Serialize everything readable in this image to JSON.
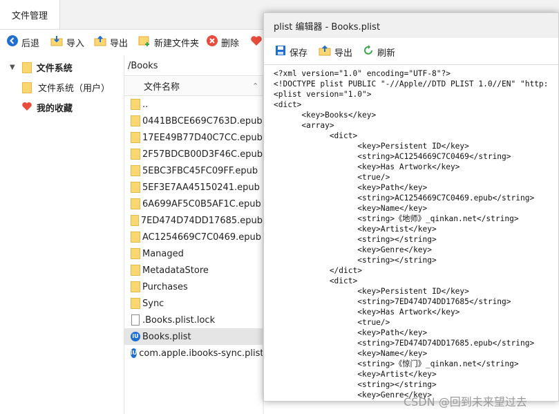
{
  "tab": {
    "label": "文件管理"
  },
  "toolbar": {
    "back": "后退",
    "import": "导入",
    "export": "导出",
    "new_folder": "新建文件夹",
    "delete": "删除"
  },
  "sidebar": {
    "filesystem": "文件系统",
    "filesystem_user": "文件系统（用户）",
    "favorites": "我的收藏"
  },
  "path": "/Books",
  "column_header": "文件名称",
  "files": [
    {
      "name": "..",
      "type": "folder"
    },
    {
      "name": "0441BBCE669C763D.epub",
      "type": "folder"
    },
    {
      "name": "17EE49B77D40C7CC.epub",
      "type": "folder"
    },
    {
      "name": "2F57BDCB00D3F46C.epub",
      "type": "folder"
    },
    {
      "name": "5EBC3FBC45FC09FF.epub",
      "type": "folder"
    },
    {
      "name": "5EF3E7AA45150241.epub",
      "type": "folder"
    },
    {
      "name": "6A699AF5C0B5AF1C.epub",
      "type": "folder"
    },
    {
      "name": "7ED474D74DD17685.epub",
      "type": "folder"
    },
    {
      "name": "AC1254669C7C0469.epub",
      "type": "folder"
    },
    {
      "name": "Managed",
      "type": "folder"
    },
    {
      "name": "MetadataStore",
      "type": "folder"
    },
    {
      "name": "Purchases",
      "type": "folder"
    },
    {
      "name": "Sync",
      "type": "folder"
    },
    {
      "name": ".Books.plist.lock",
      "type": "file"
    },
    {
      "name": "Books.plist",
      "type": "plist",
      "selected": true
    },
    {
      "name": "com.apple.ibooks-sync.plist",
      "type": "plist"
    }
  ],
  "editor": {
    "title": "plist 编辑器 - Books.plist",
    "save": "保存",
    "export": "导出",
    "refresh": "刷新",
    "lines": [
      "<?xml version=\"1.0\" encoding=\"UTF-8\"?>",
      "<!DOCTYPE plist PUBLIC \"-//Apple//DTD PLIST 1.0//EN\" \"http:",
      "<plist version=\"1.0\">",
      "<dict>",
      "      <key>Books</key>",
      "      <array>",
      "            <dict>",
      "                  <key>Persistent ID</key>",
      "                  <string>AC1254669C7C0469</string>",
      "                  <key>Has Artwork</key>",
      "                  <true/>",
      "                  <key>Path</key>",
      "                  <string>AC1254669C7C0469.epub</string>",
      "                  <key>Name</key>",
      "                  <string>《地师》_qinkan.net</string>",
      "                  <key>Artist</key>",
      "                  <string></string>",
      "                  <key>Genre</key>",
      "                  <string></string>",
      "            </dict>",
      "            <dict>",
      "                  <key>Persistent ID</key>",
      "                  <string>7ED474D74DD17685</string>",
      "                  <key>Has Artwork</key>",
      "                  <true/>",
      "                  <key>Path</key>",
      "                  <string>7ED474D74DD17685.epub</string>",
      "                  <key>Name</key>",
      "                  <string>《惊门》_qinkan.net</string>",
      "                  <key>Artist</key>",
      "                  <string></string>",
      "                  <key>Genre</key>"
    ]
  },
  "watermark": "CSDN @回到未来望过去",
  "icons": {
    "back": "back-arrow-icon",
    "import": "import-icon",
    "export": "export-icon",
    "new_folder": "new-folder-icon",
    "delete": "delete-icon",
    "favorites": "heart-icon",
    "save": "save-icon",
    "refresh": "refresh-icon"
  },
  "colors": {
    "accent_blue": "#1f6fd1",
    "folder_yellow": "#fbd772",
    "delete_red": "#e74c3c",
    "refresh_green": "#3aa44a"
  }
}
